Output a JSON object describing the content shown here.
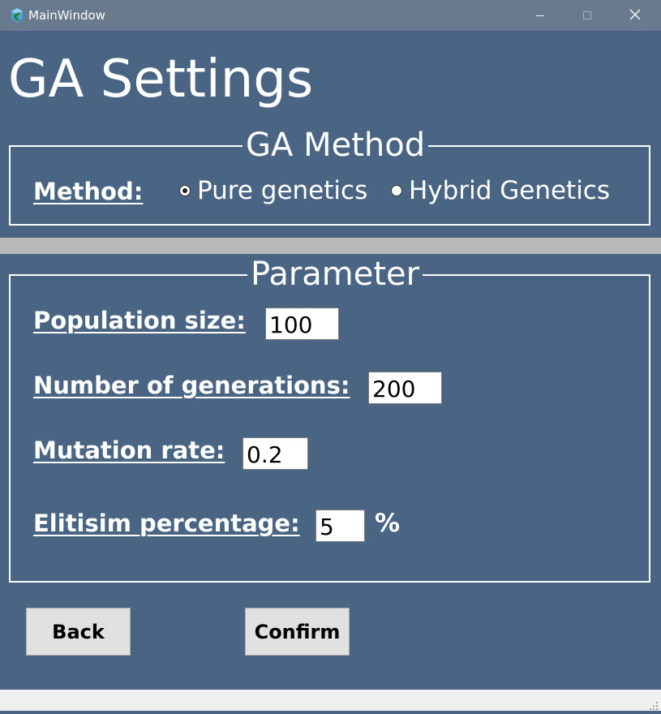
{
  "window": {
    "title": "MainWindow",
    "icon": "qt-designer-icon",
    "controls": [
      "minimize-icon",
      "maximize-icon",
      "close-icon"
    ]
  },
  "page": {
    "title": "GA Settings"
  },
  "ga_method": {
    "legend": "GA Method",
    "label": "Method:",
    "options": [
      {
        "label": "Pure genetics",
        "checked": true
      },
      {
        "label": "Hybrid Genetics",
        "checked": false
      }
    ]
  },
  "parameters": {
    "legend": "Parameter",
    "population_size": {
      "label": "Population size:",
      "value": "100"
    },
    "generations": {
      "label": "Number of generations:",
      "value": "200"
    },
    "mutation_rate": {
      "label": "Mutation rate:",
      "value": "0.2"
    },
    "elitism": {
      "label": "Elitisim percentage:",
      "value": "5",
      "unit": "%"
    }
  },
  "buttons": {
    "back": "Back",
    "confirm": "Confirm"
  },
  "colors": {
    "background": "#4a6583",
    "titlebar": "#6a7a8e",
    "button": "#e1e1e1",
    "divider": "#b9b9b9"
  }
}
